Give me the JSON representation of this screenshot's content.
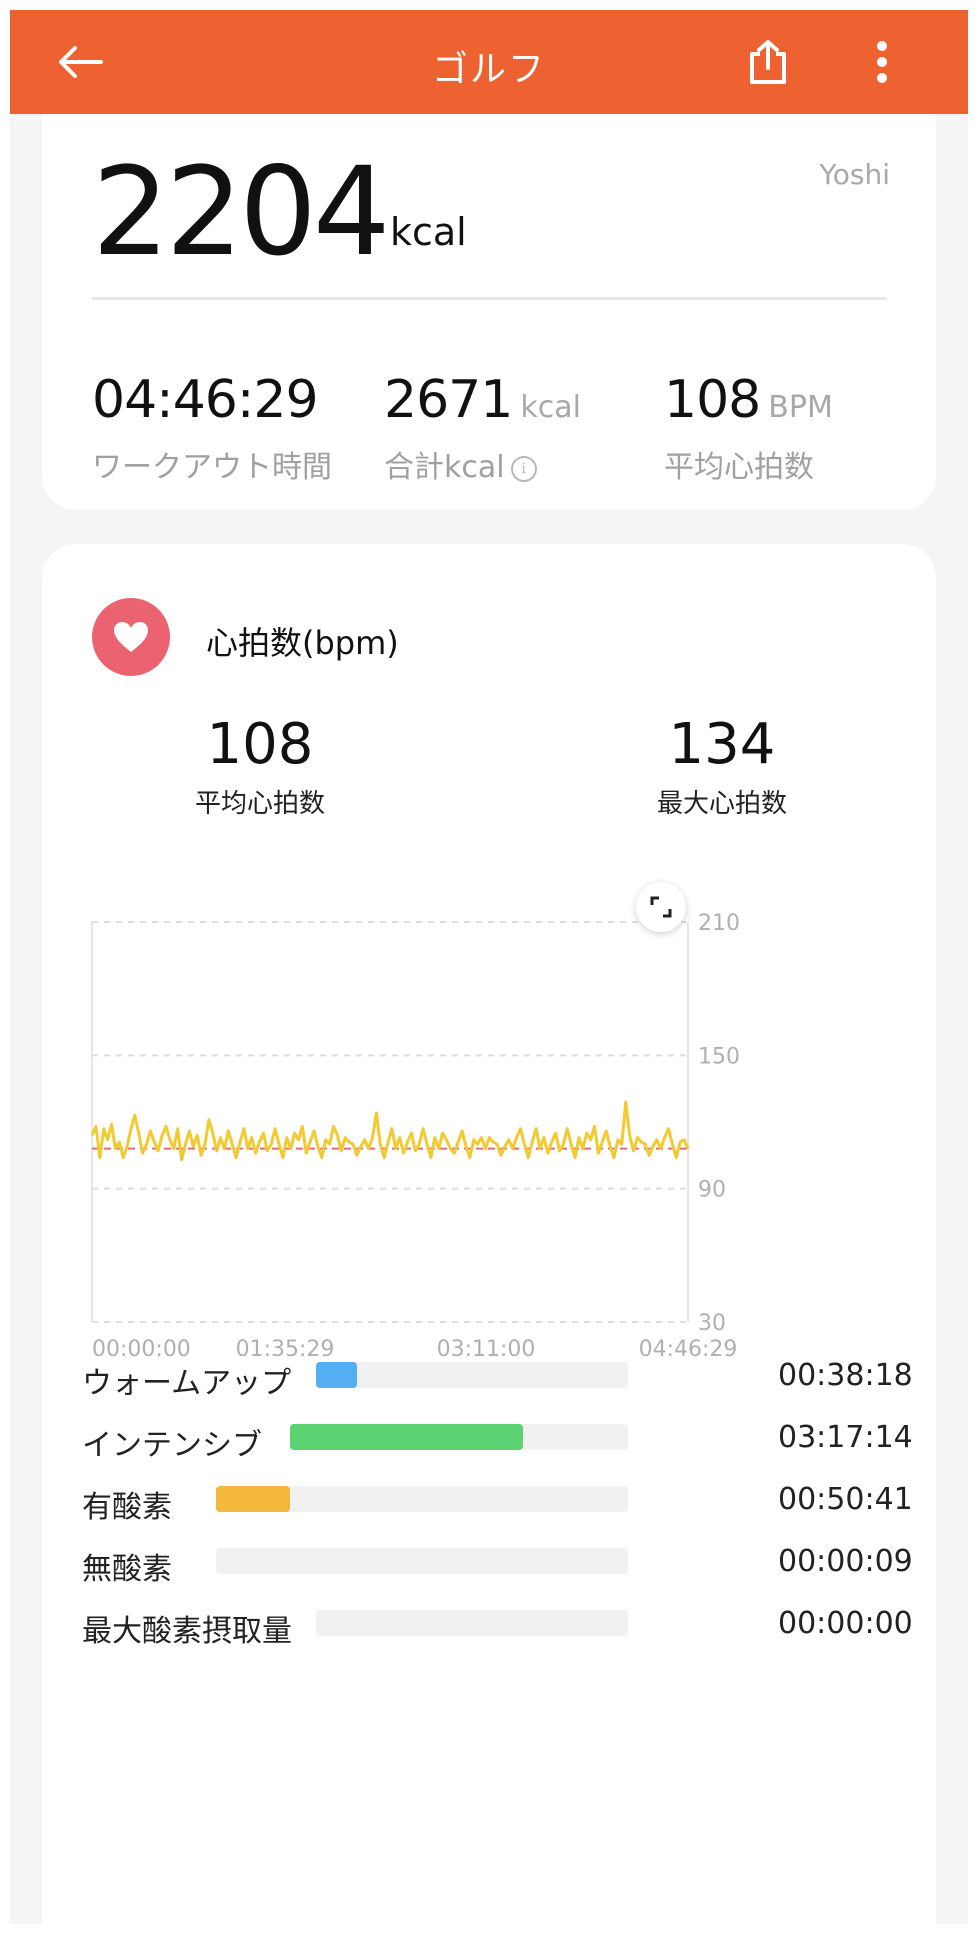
{
  "header": {
    "title": "ゴルフ",
    "back_icon": "back-arrow-icon",
    "share_icon": "share-icon",
    "menu_icon": "more-vertical-icon"
  },
  "summary": {
    "kcal_value": "2204",
    "kcal_unit": "kcal",
    "user": "Yoshi",
    "stats": [
      {
        "value": "04:46:29",
        "unit": "",
        "label": "ワークアウト時間"
      },
      {
        "value": "2671",
        "unit": "kcal",
        "label": "合計kcal"
      },
      {
        "value": "108",
        "unit": "BPM",
        "label": "平均心拍数"
      }
    ]
  },
  "heart_rate": {
    "title": "心拍数(bpm)",
    "avg_value": "108",
    "avg_label": "平均心拍数",
    "max_value": "134",
    "max_label": "最大心拍数",
    "colors": {
      "heart": "#eb6271",
      "line_high": "#f6cb32",
      "line_low": "#3ec46d",
      "avg_line": "#e56b7a"
    }
  },
  "chart_data": {
    "type": "line",
    "xlabel": "",
    "ylabel": "",
    "y_ticks": [
      "210",
      "150",
      "90",
      "30"
    ],
    "ylim": [
      30,
      210
    ],
    "x_ticks": [
      "00:00:00",
      "01:35:29",
      "03:11:00",
      "04:46:29"
    ],
    "average": 108,
    "series": [
      {
        "values": [
          114,
          118,
          104,
          117,
          112,
          119,
          108,
          111,
          104,
          109,
          117,
          123,
          115,
          106,
          110,
          116,
          111,
          107,
          114,
          118,
          112,
          108,
          117,
          103,
          110,
          116,
          109,
          114,
          105,
          110,
          121,
          115,
          107,
          113,
          108,
          116,
          110,
          104,
          111,
          117,
          108,
          113,
          106,
          111,
          115,
          107,
          110,
          117,
          110,
          104,
          113,
          108,
          115,
          112,
          118,
          106,
          111,
          116,
          109,
          104,
          112,
          110,
          118,
          114,
          107,
          113,
          111,
          110,
          105,
          109,
          112,
          108,
          113,
          124,
          110,
          104,
          111,
          117,
          108,
          113,
          106,
          111,
          115,
          107,
          110,
          117,
          110,
          104,
          113,
          108,
          115,
          112,
          108,
          106,
          111,
          116,
          109,
          104,
          112,
          110,
          113,
          108,
          113,
          111,
          110,
          105,
          109,
          112,
          108,
          113,
          117,
          110,
          104,
          111,
          117,
          108,
          113,
          106,
          111,
          115,
          107,
          110,
          117,
          110,
          104,
          113,
          108,
          115,
          112,
          118,
          106,
          111,
          116,
          109,
          104,
          112,
          110,
          129,
          114,
          107,
          113,
          111,
          110,
          105,
          109,
          112,
          108,
          113,
          117,
          110,
          104,
          111,
          112,
          108
        ],
        "x_range": [
          "00:00:00",
          "04:46:29"
        ]
      }
    ],
    "grid": true
  },
  "zones": [
    {
      "name": "ウォームアップ",
      "time": "00:38:18",
      "fraction": 0.13,
      "color": "#56aef2"
    },
    {
      "name": "インテンシブ",
      "time": "03:17:14",
      "fraction": 0.69,
      "color": "#5dd272"
    },
    {
      "name": "有酸素",
      "time": "00:50:41",
      "fraction": 0.18,
      "color": "#f3b73b"
    },
    {
      "name": "無酸素",
      "time": "00:00:09",
      "fraction": 0.0,
      "color": "#f3b73b"
    },
    {
      "name": "最大酸素摂取量",
      "time": "00:00:00",
      "fraction": 0.0,
      "color": "#f3b73b"
    }
  ]
}
